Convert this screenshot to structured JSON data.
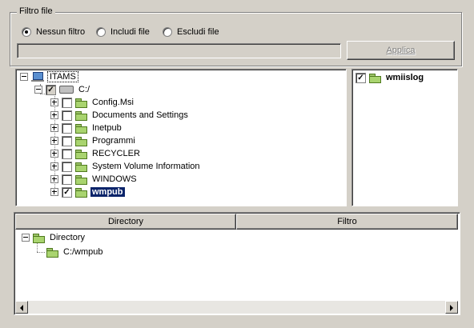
{
  "filter": {
    "group_title": "Filtro file",
    "options": [
      "Nessun filtro",
      "Includi file",
      "Escludi file"
    ],
    "selected": "Nessun filtro",
    "path_value": "",
    "apply_label": "Applica"
  },
  "tree": {
    "root": "ITAMS",
    "drive": "C:/",
    "folders": [
      {
        "label": "Config.Msi",
        "checked": false
      },
      {
        "label": "Documents and Settings",
        "checked": false
      },
      {
        "label": "Inetpub",
        "checked": false
      },
      {
        "label": "Programmi",
        "checked": false
      },
      {
        "label": "RECYCLER",
        "checked": false
      },
      {
        "label": "System Volume Information",
        "checked": false
      },
      {
        "label": "WINDOWS",
        "checked": false
      },
      {
        "label": "wmpub",
        "checked": true
      }
    ]
  },
  "right_pane": {
    "item": "wmiislog",
    "checked": true
  },
  "list": {
    "columns": [
      "Directory",
      "Filtro"
    ],
    "root_label": "Directory",
    "child_label": "C:/wmpub"
  }
}
